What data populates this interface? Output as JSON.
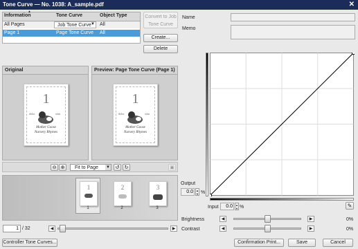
{
  "window": {
    "title": "Tone Curve — No. 1038: A_sample.pdf",
    "close_glyph": "✕"
  },
  "table": {
    "headers": [
      "Information",
      "Tone Curve",
      "Object Type"
    ],
    "rows": [
      {
        "info": "All Pages",
        "curve": "Job Tone Curve",
        "type": "All"
      },
      {
        "info": "Page 1",
        "curve": "Page Tone Curve",
        "type": "All"
      }
    ]
  },
  "buttons": {
    "convert": "Convert to Job Tone Curve",
    "create": "Create...",
    "delete": "Delete",
    "controller": "Controller Tone Curves...",
    "confirm": "Confirmation Print...",
    "save": "Save",
    "cancel": "Cancel"
  },
  "original": {
    "header": "Original"
  },
  "preview": {
    "header": "Preview: Page Tone Curve (Page 1)"
  },
  "page_art": {
    "number": "1",
    "line1": "Mother Goose",
    "line2": "Nursery Rhymes",
    "small_left": "dolor",
    "small_right": "sitm"
  },
  "zoom": {
    "selected": "Fit to Page"
  },
  "thumbnails": [
    {
      "number": "1",
      "label": "1"
    },
    {
      "number": "2",
      "label": "2"
    },
    {
      "number": "3",
      "label": "3"
    }
  ],
  "pager": {
    "current": "1",
    "total": "/ 32"
  },
  "form": {
    "name_label": "Name",
    "name_value": "",
    "memo_label": "Memo",
    "memo_value": ""
  },
  "curve": {
    "output_label": "Output",
    "output_value": "0.0",
    "output_unit": "%",
    "input_label": "Input",
    "input_value": "0.0",
    "input_unit": "%",
    "points": [
      [
        0,
        0
      ],
      [
        100,
        100
      ]
    ]
  },
  "brightness": {
    "label": "Brightness",
    "value": "0%"
  },
  "contrast": {
    "label": "Contrast",
    "value": "0%"
  },
  "colors": {
    "titlebar": "#1b2c5a",
    "selected_row": "#4a9bd8"
  }
}
